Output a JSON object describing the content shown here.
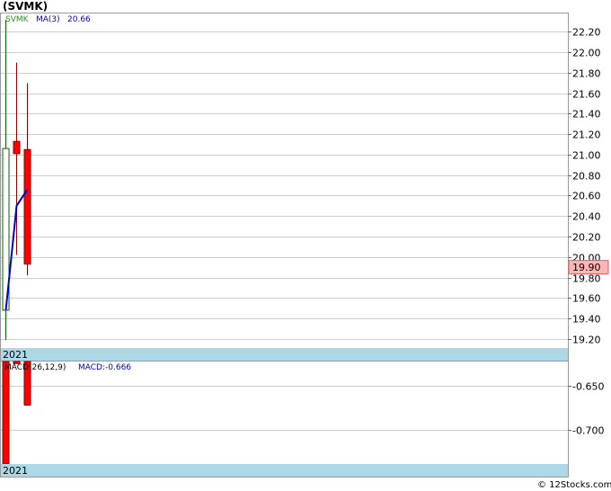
{
  "header": {
    "title": "(SVMK)"
  },
  "legend": {
    "symbol": "SVMK",
    "ma_label": "MA(3)",
    "ma_value": "20.66",
    "macd_label": "MACD(26,12,9)",
    "macd_value": "MACD:-0.666"
  },
  "footer": {
    "credit": "© 12Stocks.com"
  },
  "colors": {
    "up": "#ffffff",
    "down": "#ff0000",
    "wick_up": "#006400",
    "wick_down": "#8b0000",
    "ma_line": "#0000cc",
    "year_band": "#add8e6",
    "grid": "#cccccc",
    "price_tag_bg": "#ffb6b6"
  },
  "chart_data": [
    {
      "type": "candlestick",
      "title": "(SVMK)",
      "year_label": "2021",
      "ylim": [
        19.11,
        22.38
      ],
      "y_ticks": [
        19.2,
        19.4,
        19.6,
        19.8,
        20.0,
        20.2,
        20.4,
        20.6,
        20.8,
        21.0,
        21.2,
        21.4,
        21.6,
        21.8,
        22.0,
        22.2
      ],
      "y_tick_labels": [
        "19.20",
        "19.40",
        "19.60",
        "19.80",
        "20.00",
        "20.20",
        "20.40",
        "20.60",
        "20.80",
        "21.00",
        "21.20",
        "21.40",
        "21.60",
        "21.80",
        "22.00",
        "22.20"
      ],
      "last_price": 19.9,
      "last_price_label": "19.90",
      "candles": [
        {
          "open": 19.48,
          "close": 21.06,
          "high": 22.32,
          "low": 19.19
        },
        {
          "open": 21.13,
          "close": 21.01,
          "high": 21.9,
          "low": 20.02
        },
        {
          "open": 21.05,
          "close": 19.93,
          "high": 21.7,
          "low": 19.82
        }
      ],
      "series": [
        {
          "name": "MA(3)",
          "values": [
            19.48,
            20.5,
            20.66
          ]
        }
      ]
    },
    {
      "type": "bar",
      "title": "MACD(26,12,9)",
      "year_label": "2021",
      "ylim": [
        -0.7395,
        -0.6218
      ],
      "y_ticks": [
        -0.65,
        -0.7
      ],
      "y_tick_labels": [
        "-0.650",
        "-0.700"
      ],
      "bars": [
        {
          "top": -0.6218,
          "bottom": -0.7395
        },
        {
          "top": -0.6218,
          "bottom": -0.6241
        },
        {
          "top": -0.6218,
          "bottom": -0.6718
        }
      ]
    }
  ]
}
